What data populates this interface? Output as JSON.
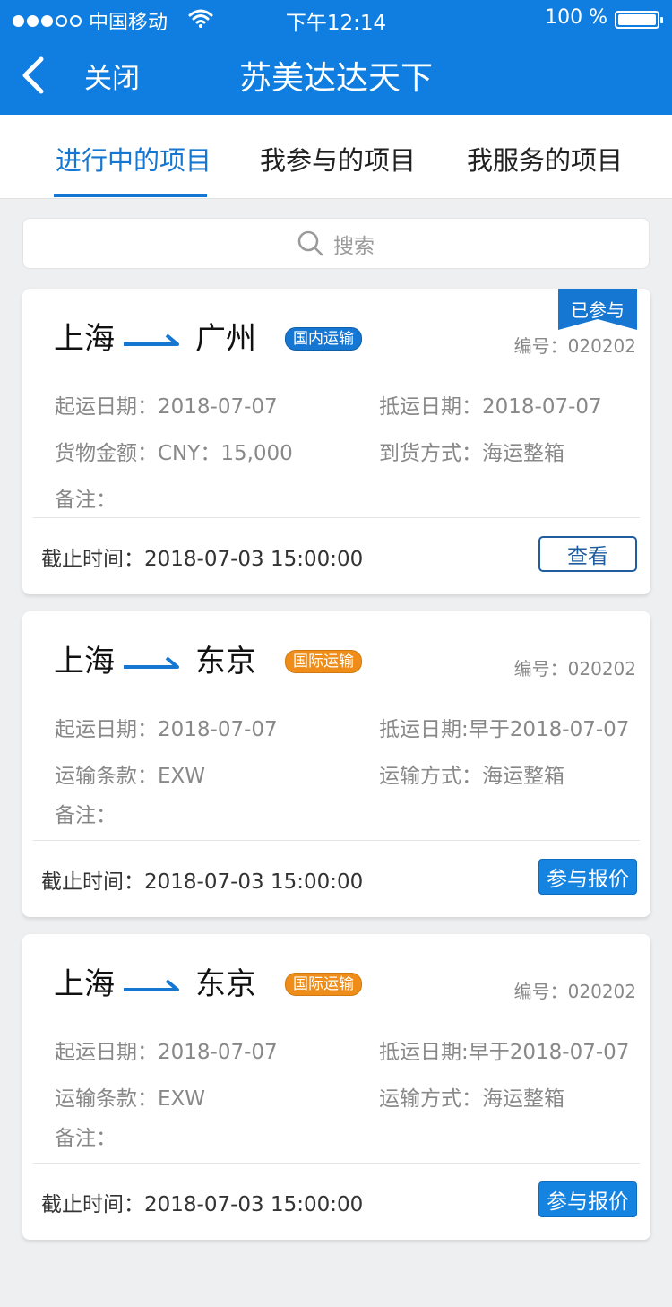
{
  "status_bar": {
    "carrier": "中国移动",
    "time": "下午12:14",
    "battery_text": "100 %",
    "battery_level": 1.0
  },
  "nav": {
    "close_label": "关闭",
    "title": "苏美达达天下"
  },
  "tabs": [
    {
      "label": "进行中的项目",
      "active": true
    },
    {
      "label": "我参与的项目",
      "active": false
    },
    {
      "label": "我服务的项目",
      "active": false
    }
  ],
  "search": {
    "placeholder": "搜索"
  },
  "colors": {
    "brand": "#0f7ee0",
    "domestic_badge": "#1577d2",
    "international_badge": "#ee8d1a",
    "ribbon": "#1577d2"
  },
  "cards": [
    {
      "origin": "上海",
      "destination": "广州",
      "badge": "国内运输",
      "ribbon": "已参与",
      "code": "编号：020202",
      "left_1": "起运日期：2018-07-07",
      "right_1": "抵运日期：2018-07-07",
      "left_2": "货物金额：CNY：15,000",
      "right_2": "到货方式：海运整箱",
      "note": "备注：",
      "deadline": "截止时间：2018-07-03 15:00:00",
      "action": "查看"
    },
    {
      "origin": "上海",
      "destination": "东京",
      "badge": "国际运输",
      "ribbon": "",
      "code": "编号：020202",
      "left_1": "起运日期：2018-07-07",
      "right_1": "抵运日期:早于2018-07-07",
      "left_2": "运输条款：EXW",
      "right_2": "运输方式：海运整箱",
      "note": "备注：",
      "deadline": "截止时间：2018-07-03 15:00:00",
      "action": "参与报价"
    },
    {
      "origin": "上海",
      "destination": "东京",
      "badge": "国际运输",
      "ribbon": "",
      "code": "编号：020202",
      "left_1": "起运日期：2018-07-07",
      "right_1": "抵运日期:早于2018-07-07",
      "left_2": "运输条款：EXW",
      "right_2": "运输方式：海运整箱",
      "note": "备注：",
      "deadline": "截止时间：2018-07-03 15:00:00",
      "action": "参与报价"
    }
  ]
}
